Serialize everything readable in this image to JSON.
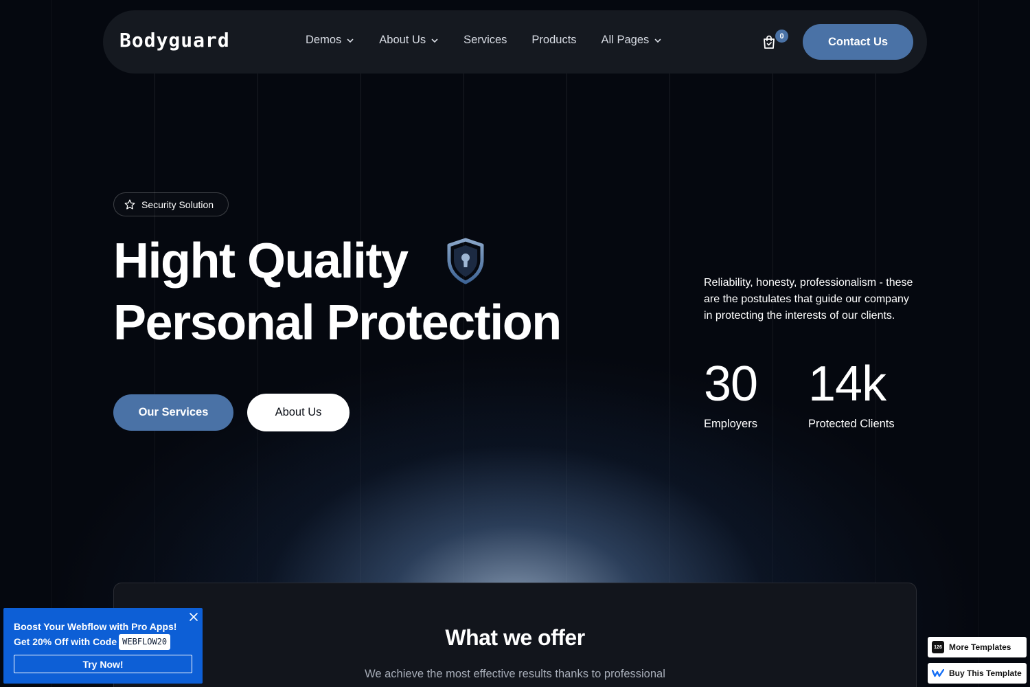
{
  "navbar": {
    "logo": "Bodyguard",
    "menu": [
      {
        "label": "Demos",
        "dropdown": true
      },
      {
        "label": "About Us",
        "dropdown": true
      },
      {
        "label": "Services",
        "dropdown": false
      },
      {
        "label": "Products",
        "dropdown": false
      },
      {
        "label": "All Pages",
        "dropdown": true
      }
    ],
    "cart_count": "0",
    "contact_label": "Contact Us"
  },
  "hero": {
    "badge": "Security Solution",
    "title_line1": "Hight Quality",
    "title_line2": "Personal Protection",
    "primary_button": "Our Services",
    "secondary_button": "About Us",
    "tagline": "Reliability, honesty, professionalism - these are the postulates that guide our company in protecting the interests of our clients.",
    "stats": [
      {
        "value": "30",
        "label": "Employers"
      },
      {
        "value": "14k",
        "label": "Protected Clients"
      }
    ]
  },
  "offer": {
    "title": "What we offer",
    "text": "We achieve the most effective results thanks to professional"
  },
  "promo": {
    "line1": "Boost Your Webflow with Pro Apps!",
    "line2": "Get 20% Off with Code",
    "code": "WEBFLOW20",
    "button": "Try Now!"
  },
  "template_badges": {
    "more": "More Templates",
    "buy": "Buy This Template"
  },
  "colors": {
    "accent": "#4a72a6",
    "background": "#05080f",
    "promo": "#0d5fd6"
  }
}
